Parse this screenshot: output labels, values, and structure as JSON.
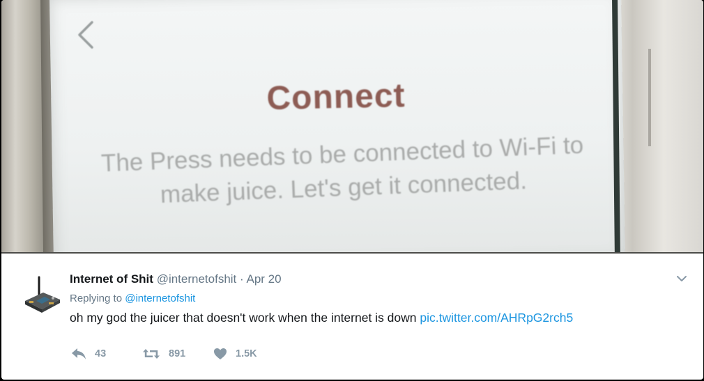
{
  "photo": {
    "back_icon": "chevron-left-icon",
    "screen_title": "Connect",
    "screen_body_line1": "The Press needs to be connected to Wi-Fi to",
    "screen_body_line2": "make juice. Let's get it connected."
  },
  "tweet": {
    "avatar_icon": "circuit-board-icon",
    "display_name": "Internet of Shit",
    "handle": "@internetofshit",
    "separator": "·",
    "date": "Apr 20",
    "menu_icon": "chevron-down-icon",
    "replying_prefix": "Replying to",
    "replying_handle": "@internetofshit",
    "text": "oh my god the juicer that doesn't work when the internet is down",
    "link": "pic.twitter.com/AHRpG2rch5",
    "actions": {
      "reply": {
        "icon": "reply-icon",
        "count": "43"
      },
      "retweet": {
        "icon": "retweet-icon",
        "count": "891"
      },
      "like": {
        "icon": "heart-icon",
        "count": "1.5K"
      }
    }
  },
  "colors": {
    "link": "#1b95e0",
    "secondary_text": "#657786",
    "action_gray": "#8899a6",
    "title_rust": "#8d5c54"
  }
}
